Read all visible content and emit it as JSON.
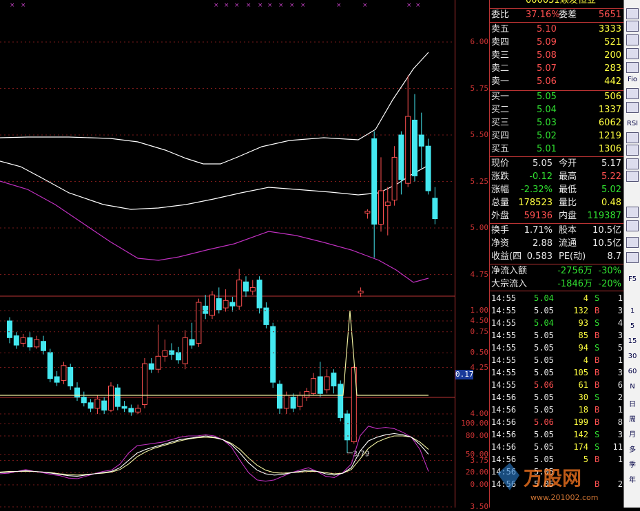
{
  "stock": {
    "code_partial": "000031",
    "name_partial": "顺发恒业"
  },
  "colors": {
    "up": "#ff5050",
    "down": "#44e8f0",
    "border": "#b33333",
    "ma": "#ffffff",
    "boll_lower": "#c030c0"
  },
  "axis_main": [
    "6.00",
    "5.75",
    "5.50",
    "5.25",
    "5.00",
    "4.75",
    "4.50",
    "4.25",
    "4.00",
    "3.75",
    "3.50"
  ],
  "axis_vol": [
    "1.00",
    "0.75",
    "0.50"
  ],
  "vol_current": "0.17",
  "axis_kdj": [
    "100.00",
    "80.00",
    "50.00",
    "20.00",
    "0.00"
  ],
  "low_label": "3.79",
  "order_book": {
    "wb_label": "委比",
    "wb_value": "37.16%",
    "wc_label": "委差",
    "wc_value": "5651",
    "asks": [
      {
        "label": "卖五",
        "price": "5.10",
        "vol": "3333"
      },
      {
        "label": "卖四",
        "price": "5.09",
        "vol": "521"
      },
      {
        "label": "卖三",
        "price": "5.08",
        "vol": "200"
      },
      {
        "label": "卖二",
        "price": "5.07",
        "vol": "283"
      },
      {
        "label": "卖一",
        "price": "5.06",
        "vol": "442"
      }
    ],
    "bids": [
      {
        "label": "买一",
        "price": "5.05",
        "vol": "506"
      },
      {
        "label": "买二",
        "price": "5.04",
        "vol": "1337"
      },
      {
        "label": "买三",
        "price": "5.03",
        "vol": "6062"
      },
      {
        "label": "买四",
        "price": "5.02",
        "vol": "1219"
      },
      {
        "label": "买五",
        "price": "5.01",
        "vol": "1306"
      }
    ]
  },
  "quote": [
    {
      "l1": "现价",
      "v1": "5.05",
      "c1": "white",
      "l2": "今开",
      "v2": "5.17",
      "c2": "white"
    },
    {
      "l1": "涨跌",
      "v1": "-0.12",
      "c1": "green",
      "l2": "最高",
      "v2": "5.22",
      "c2": "red"
    },
    {
      "l1": "涨幅",
      "v1": "-2.32%",
      "c1": "green",
      "l2": "最低",
      "v2": "5.02",
      "c2": "green"
    },
    {
      "l1": "总量",
      "v1": "178523",
      "c1": "yellow",
      "l2": "量比",
      "v2": "0.48",
      "c2": "yellow"
    },
    {
      "l1": "外盘",
      "v1": "59136",
      "c1": "red",
      "l2": "内盘",
      "v2": "119387",
      "c2": "green"
    }
  ],
  "fundamentals": [
    {
      "l1": "换手",
      "v1": "1.71%",
      "l2": "股本",
      "v2": "10.5亿"
    },
    {
      "l1": "净资",
      "v1": "2.88",
      "l2": "流通",
      "v2": "10.5亿"
    },
    {
      "l1": "收益(四",
      "v1": "0.583",
      "l2": "PE(动)",
      "v2": "8.7"
    }
  ],
  "flows": [
    {
      "label": "净流入额",
      "value": "-2756万",
      "pct": "-30%"
    },
    {
      "label": "大宗流入",
      "value": "-1846万",
      "pct": "-20%"
    }
  ],
  "trades": [
    {
      "t": "14:55",
      "p": "5.04",
      "v": "4",
      "s": "S",
      "n": "1"
    },
    {
      "t": "14:55",
      "p": "5.05",
      "v": "132",
      "s": "B",
      "n": "3"
    },
    {
      "t": "14:55",
      "p": "5.04",
      "v": "93",
      "s": "S",
      "n": "4"
    },
    {
      "t": "14:55",
      "p": "5.05",
      "v": "85",
      "s": "B",
      "n": "3"
    },
    {
      "t": "14:55",
      "p": "5.05",
      "v": "94",
      "s": "S",
      "n": "5"
    },
    {
      "t": "14:55",
      "p": "5.05",
      "v": "4",
      "s": "B",
      "n": "1"
    },
    {
      "t": "14:55",
      "p": "5.05",
      "v": "105",
      "s": "B",
      "n": "3"
    },
    {
      "t": "14:55",
      "p": "5.06",
      "v": "61",
      "s": "B",
      "n": "6"
    },
    {
      "t": "14:56",
      "p": "5.05",
      "v": "30",
      "s": "S",
      "n": "2"
    },
    {
      "t": "14:56",
      "p": "5.05",
      "v": "18",
      "s": "B",
      "n": "1"
    },
    {
      "t": "14:56",
      "p": "5.06",
      "v": "199",
      "s": "B",
      "n": "8"
    },
    {
      "t": "14:56",
      "p": "5.05",
      "v": "142",
      "s": "S",
      "n": "3"
    },
    {
      "t": "14:56",
      "p": "5.05",
      "v": "174",
      "s": "S",
      "n": "11"
    },
    {
      "t": "14:56",
      "p": "5.05",
      "v": "5",
      "s": "B",
      "n": "1"
    },
    {
      "t": "14:56",
      "p": "5.05",
      "v": "",
      "s": "",
      "n": ""
    },
    {
      "t": "14:56",
      "p": "5.05",
      "v": "",
      "s": "B",
      "n": "2"
    }
  ],
  "toolbar": {
    "labels": [
      "Fio",
      "RSI",
      "F5",
      "1",
      "5",
      "15",
      "30",
      "60",
      "N",
      "日",
      "周",
      "月",
      "多",
      "季",
      "年"
    ]
  },
  "watermark": {
    "text": "万股网",
    "url": "www.201002.com"
  },
  "candles": [
    [
      4.5,
      4.41,
      4.52,
      4.38
    ],
    [
      4.42,
      4.37,
      4.44,
      4.35
    ],
    [
      4.38,
      4.41,
      4.43,
      4.36
    ],
    [
      4.41,
      4.36,
      4.44,
      4.34
    ],
    [
      4.36,
      4.4,
      4.42,
      4.35
    ],
    [
      4.39,
      4.34,
      4.42,
      4.32
    ],
    [
      4.33,
      4.19,
      4.35,
      4.17
    ],
    [
      4.2,
      4.17,
      4.23,
      4.15
    ],
    [
      4.18,
      4.26,
      4.28,
      4.16
    ],
    [
      4.25,
      4.15,
      4.27,
      4.13
    ],
    [
      4.14,
      4.09,
      4.17,
      4.07
    ],
    [
      4.09,
      4.06,
      4.12,
      4.04
    ],
    [
      4.06,
      4.03,
      4.08,
      4.01
    ],
    [
      4.03,
      4.08,
      4.1,
      4.0
    ],
    [
      4.07,
      4.02,
      4.09,
      4.0
    ],
    [
      4.02,
      4.15,
      4.17,
      4.01
    ],
    [
      4.14,
      4.04,
      4.16,
      4.02
    ],
    [
      4.04,
      4.03,
      4.07,
      4.01
    ],
    [
      4.03,
      4.01,
      4.05,
      3.99
    ],
    [
      4.01,
      4.03,
      4.05,
      4.0
    ],
    [
      4.05,
      4.27,
      4.3,
      4.03
    ],
    [
      4.27,
      4.24,
      4.3,
      4.22
    ],
    [
      4.24,
      4.31,
      4.48,
      4.22
    ],
    [
      4.31,
      4.34,
      4.4,
      4.28
    ],
    [
      4.34,
      4.32,
      4.38,
      4.29
    ],
    [
      4.33,
      4.29,
      4.36,
      4.27
    ],
    [
      4.27,
      4.41,
      4.45,
      4.24
    ],
    [
      4.4,
      4.37,
      4.49,
      4.35
    ],
    [
      4.38,
      4.6,
      4.62,
      4.36
    ],
    [
      4.58,
      4.54,
      4.64,
      4.51
    ],
    [
      4.53,
      4.64,
      4.66,
      4.51
    ],
    [
      4.62,
      4.56,
      4.68,
      4.54
    ],
    [
      4.57,
      4.61,
      4.67,
      4.55
    ],
    [
      4.6,
      4.58,
      4.63,
      4.55
    ],
    [
      4.58,
      4.72,
      4.78,
      4.56
    ],
    [
      4.71,
      4.66,
      4.74,
      4.63
    ],
    [
      4.66,
      4.68,
      4.72,
      4.64
    ],
    [
      4.72,
      4.57,
      4.74,
      4.54
    ],
    [
      4.57,
      4.48,
      4.6,
      4.46
    ],
    [
      4.47,
      4.17,
      4.49,
      4.14
    ],
    [
      4.16,
      4.03,
      4.18,
      4.0
    ],
    [
      4.03,
      4.1,
      4.12,
      4.0
    ],
    [
      4.09,
      4.03,
      4.11,
      4.01
    ],
    [
      4.04,
      4.1,
      4.12,
      4.02
    ],
    [
      4.09,
      4.12,
      4.14,
      4.07
    ],
    [
      4.11,
      4.19,
      4.22,
      4.1
    ],
    [
      4.2,
      4.11,
      4.28,
      4.09
    ],
    [
      4.13,
      4.2,
      4.24,
      4.11
    ],
    [
      4.22,
      4.15,
      4.24,
      4.11
    ],
    [
      4.16,
      3.98,
      4.18,
      3.96
    ],
    [
      4.0,
      3.86,
      4.02,
      3.79
    ],
    [
      3.85,
      4.25,
      4.26,
      3.84
    ],
    [
      4.65,
      4.66,
      4.68,
      4.63
    ],
    [
      5.08,
      5.09,
      5.1,
      5.05
    ],
    [
      5.48,
      5.02,
      5.52,
      4.84
    ],
    [
      5.02,
      5.2,
      5.38,
      4.98
    ],
    [
      5.12,
      5.14,
      5.22,
      4.96
    ],
    [
      5.15,
      5.38,
      5.44,
      5.12
    ],
    [
      5.5,
      5.26,
      5.52,
      5.18
    ],
    [
      5.24,
      5.6,
      5.82,
      5.22
    ],
    [
      5.58,
      5.28,
      5.72,
      5.25
    ],
    [
      5.5,
      5.44,
      5.62,
      5.32
    ],
    [
      5.44,
      5.2,
      5.48,
      5.18
    ],
    [
      5.16,
      5.05,
      5.22,
      5.02
    ]
  ],
  "kdj": {
    "k": [
      20,
      21,
      22,
      23,
      22,
      21,
      19,
      17,
      15,
      14,
      16,
      18,
      20,
      22,
      28,
      40,
      52,
      58,
      62,
      66,
      70,
      74,
      76,
      78,
      80,
      78,
      74,
      66,
      52,
      36,
      24,
      18,
      16,
      17,
      20,
      22,
      24,
      22,
      18,
      16,
      19,
      28,
      55,
      72,
      78,
      82,
      84,
      82,
      78,
      66,
      50
    ],
    "d": [
      21,
      22,
      22,
      22,
      22,
      21,
      20,
      18,
      17,
      16,
      17,
      18,
      19,
      21,
      25,
      34,
      46,
      54,
      60,
      64,
      68,
      72,
      75,
      77,
      78,
      77,
      74,
      68,
      58,
      44,
      32,
      24,
      20,
      19,
      20,
      21,
      22,
      22,
      20,
      18,
      19,
      25,
      42,
      60,
      70,
      76,
      80,
      80,
      78,
      70,
      58
    ],
    "j": [
      18,
      19,
      22,
      25,
      22,
      20,
      17,
      15,
      11,
      10,
      14,
      18,
      22,
      24,
      34,
      52,
      64,
      66,
      68,
      70,
      74,
      78,
      80,
      80,
      82,
      80,
      74,
      62,
      40,
      20,
      8,
      6,
      8,
      14,
      20,
      24,
      28,
      22,
      14,
      12,
      20,
      34,
      80,
      96,
      92,
      94,
      92,
      86,
      78,
      58,
      22
    ]
  }
}
